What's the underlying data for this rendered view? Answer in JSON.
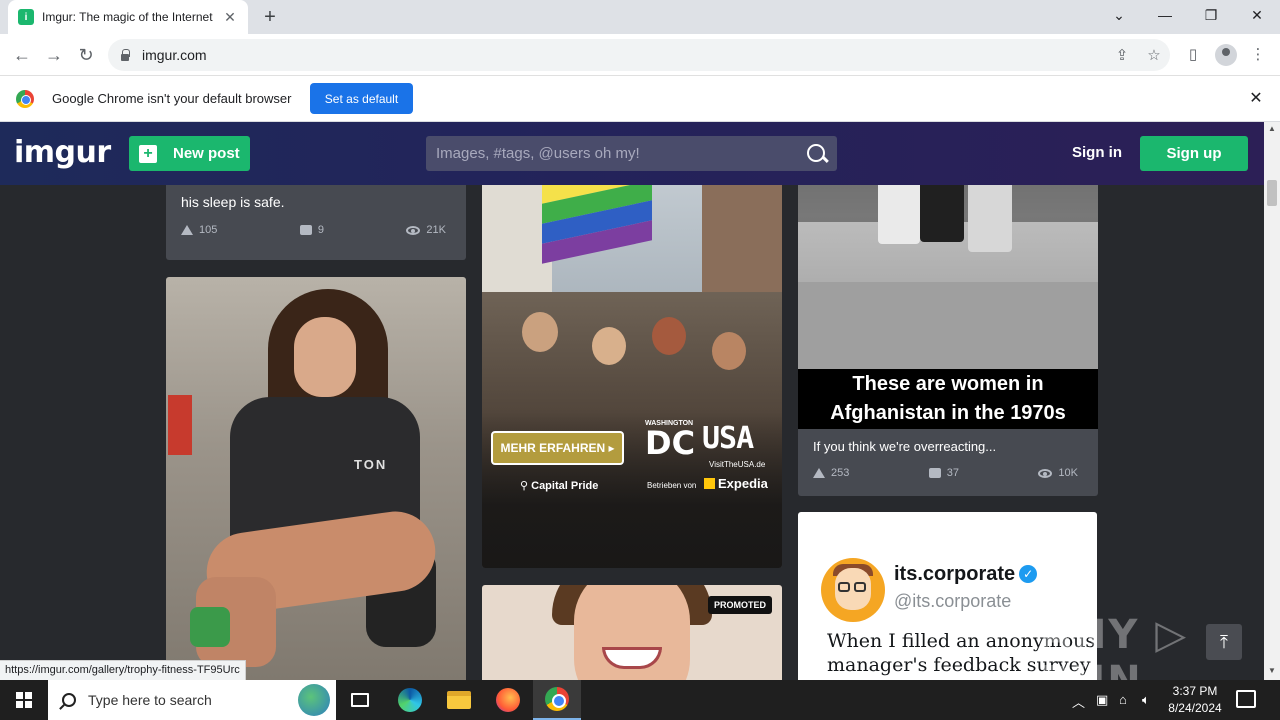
{
  "browser": {
    "tab_title": "Imgur: The magic of the Internet",
    "url": "imgur.com",
    "infobar_text": "Google Chrome isn't your default browser",
    "infobar_button": "Set as default",
    "status_url": "https://imgur.com/gallery/trophy-fitness-TF95Urc"
  },
  "imgur": {
    "logo": "imgur",
    "new_post_label": "New post",
    "search_placeholder": "Images, #tags, @users oh my!",
    "sign_in": "Sign in",
    "sign_up": "Sign up",
    "brand_color": "#1bb76e"
  },
  "posts": [
    {
      "caption": "his sleep is safe.",
      "upvotes": "105",
      "comments": "9",
      "views": "21K"
    },
    {
      "image_text": "TON"
    },
    {
      "promo": {
        "cta": "MEHR ERFAHREN ▸",
        "location": "Capital Pride",
        "city_small": "WASHINGTON",
        "city": "DC",
        "country": "USA",
        "site": "VisitTheUSA.de",
        "operated_by": "Betrieben von",
        "partner": "Expedia"
      }
    },
    {
      "badge": "PROMOTED"
    },
    {
      "banner_line1": "These are women in",
      "banner_line2": "Afghanistan in the 1970s",
      "caption": "If you think we're overreacting...",
      "upvotes": "253",
      "comments": "37",
      "views": "10K"
    },
    {
      "name": "its.corporate",
      "handle": "@its.corporate",
      "text": "When I filled an anonymous manager's feedback survey"
    }
  ],
  "watermark": "ANY ▷ RUN",
  "taskbar": {
    "search_placeholder": "Type here to search",
    "time": "3:37 PM",
    "date": "8/24/2024"
  }
}
